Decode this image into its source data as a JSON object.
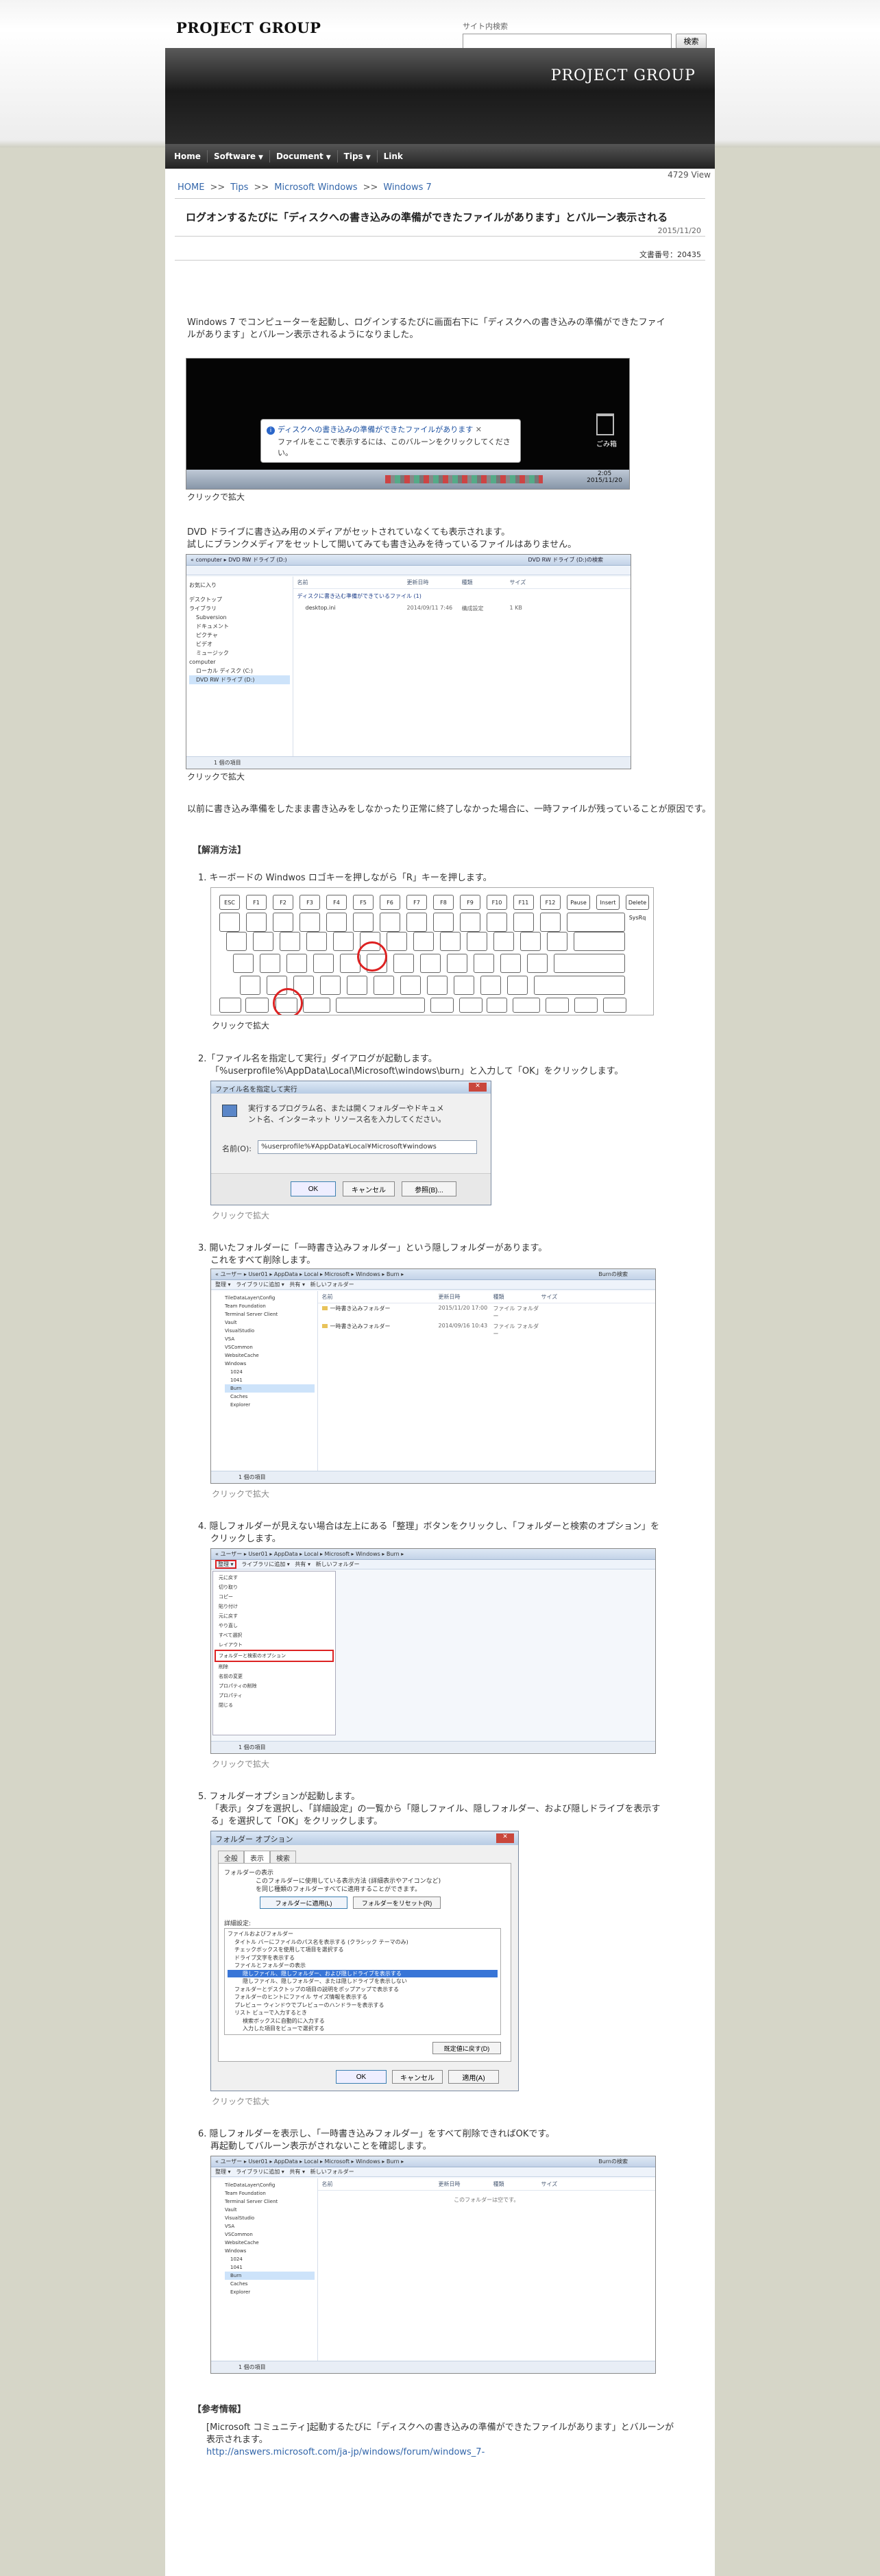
{
  "header": {
    "logo_text": "PROJECT GROUP",
    "search_label": "サイト内検索",
    "search_button": "検索",
    "search_value": ""
  },
  "banner": {
    "title": "PROJECT GROUP"
  },
  "nav": {
    "items": [
      {
        "label": "Home"
      },
      {
        "label": "Software",
        "dropdown": true
      },
      {
        "label": "Document",
        "dropdown": true
      },
      {
        "label": "Tips",
        "dropdown": true
      },
      {
        "label": "Link"
      }
    ]
  },
  "article": {
    "views": "4729 View",
    "breadcrumb": [
      "HOME",
      "Tips",
      "Microsoft Windows",
      "Windows 7"
    ],
    "breadcrumb_sep": ">>",
    "title": "ログオンするたびに「ディスクへの書き込みの準備ができたファイルがあります」とバルーン表示される",
    "date": "2015/11/20",
    "doc_no": "文書番号：20435",
    "intro_1": "Windows 7 でコンピューターを起動し、ログインするたびに画面右下に「ディスクへの書き込みの準備ができたファイ",
    "intro_2": "ルがあります」とバルーン表示されるようになりました。",
    "balloon_title": "ディスクへの書き込みの準備ができたファイルがあります",
    "balloon_body_1": "ファイルをここで表示するには、このバルーンをクリックしてくださ",
    "balloon_body_2": "い。",
    "recycle_label": "ごみ箱",
    "tray_time": "2:05",
    "tray_date": "2015/11/20",
    "enlarge": "クリックで拡大",
    "para_2a": "DVD ドライブに書き込み用のメディアがセットされていなくても表示されます。",
    "para_2b": "試しにブランクメディアをセットして開いてみても書き込みを待っているファイルはありません。",
    "para_3": "以前に書き込み準備をしたまま書き込みをしなかったり正常に終了しなかった場合に、一時ファイルが残っていることが原因です。",
    "solution_heading": "【解消方法】",
    "steps": [
      {
        "text": "1. キーボードの Windwos ロゴキーを押しながら「R」キーを押します。"
      },
      {
        "text": "2.「ファイル名を指定して実行」ダイアログが起動します。",
        "text2": "「%userprofile%\\AppData\\Local\\Microsoft\\windows\\burn」と入力して「OK」をクリックします。"
      },
      {
        "text": "3. 開いたフォルダーに「一時書き込みフォルダー」という隠しフォルダーがあります。",
        "text2": "これをすべて削除します。"
      },
      {
        "text": "4. 隠しフォルダーが見えない場合は左上にある「整理」ボタンをクリックし、「フォルダーと検索のオプション」を",
        "text2": "クリックします。"
      },
      {
        "text": "5. フォルダーオプションが起動します。",
        "text2": "「表示」タブを選択し、「詳細設定」の一覧から「隠しファイル、隠しフォルダー、および隠しドライブを表示す",
        "text3": "る」を選択して「OK」をクリックします。"
      },
      {
        "text": "6. 隠しフォルダーを表示し、「一時書き込みフォルダー」をすべて削除できればOKです。",
        "text2": "再起動してバルーン表示がされないことを確認します。"
      }
    ],
    "run_dialog": {
      "title": "ファイル名を指定して実行",
      "desc_1": "実行するプログラム名、または開くフォルダーやドキュメ",
      "desc_2": "ント名、インターネット リソース名を入力してください。",
      "name_label": "名前(O):",
      "name_value": "%userprofile%¥AppData¥Local¥Microsoft¥windows",
      "ok": "OK",
      "cancel": "キャンセル",
      "browse": "参照(B)..."
    },
    "explorer_1": {
      "path": "« computer ▸ DVD RW ドライブ (D:)",
      "search": "DVD RW ドライブ (D:)の検索",
      "col_name": "名前",
      "col_date": "更新日時",
      "col_type": "種類",
      "col_size": "サイズ",
      "group": "ディスクに書き込む準備ができているファイル (1)",
      "file_name": "desktop.ini",
      "file_date": "2014/09/11 7:46",
      "file_type": "構成設定",
      "file_size": "1 KB",
      "sidebar": [
        "お気に入り",
        "デスクトップ",
        "ライブラリ",
        "Subversion",
        "ドキュメント",
        "ピクチャ",
        "ビデオ",
        "ミュージック",
        "computer",
        "ローカル ディスク (C:)",
        "DVD RW ドライブ (D:)"
      ],
      "status": "1 個の項目"
    },
    "explorer_2": {
      "path": "« ユーザー ▸ User01 ▸ AppData ▸ Local ▸ Microsoft ▸ Windows ▸ Burn ▸",
      "search": "Burnの検索",
      "organize": "整理 ▾",
      "library": "ライブラリに追加 ▾",
      "share": "共有 ▾",
      "newfolder": "新しいフォルダー",
      "rows": [
        "一時書き込みフォルダー",
        "一時書き込みフォルダー"
      ],
      "row_dates": [
        "2015/11/20 17:00",
        "2014/09/16 10:43"
      ],
      "row_type": "ファイル フォルダー",
      "sidebar": [
        "TileDataLayer\\Config",
        "Team Foundation",
        "Terminal Server Client",
        "Vault",
        "VisualStudio",
        "VSA",
        "VSCommon",
        "WebsiteCache",
        "Windows",
        "1024",
        "1041",
        "Burn",
        "Caches",
        "Explorer"
      ],
      "status": "1 個の項目",
      "empty": "このフォルダーは空です。"
    },
    "organize_menu": [
      "元に戻す",
      "切り取り",
      "コピー",
      "貼り付け",
      "元に戻す",
      "やり直し",
      "すべて選択",
      "レイアウト",
      "フォルダーと検索のオプション",
      "削除",
      "名前の変更",
      "プロパティの削除",
      "プロパティ",
      "閉じる"
    ],
    "folder_options": {
      "title": "フォルダー オプション",
      "tabs": [
        "全般",
        "表示",
        "検索"
      ],
      "folder_view": "フォルダーの表示",
      "folder_view_desc_1": "このフォルダーに使用している表示方法 (詳細表示やアイコンなど)",
      "folder_view_desc_2": "を同じ種類のフォルダーすべてに適用することができます。",
      "apply_btn": "フォルダーに適用(L)",
      "reset_btn": "フォルダーをリセット(R)",
      "advanced": "詳細設定:",
      "items": [
        "ファイルおよびフォルダー",
        "タイトル バーにファイルのパス名を表示する (クラシック テーマのみ)",
        "チェックボックスを使用して項目を選択する",
        "ドライブ文字を表示する",
        "ファイルとフォルダーの表示",
        "隠しファイル、隠しフォルダー、および隠しドライブを表示する",
        "隠しファイル、隠しフォルダー、または隠しドライブを表示しない",
        "フォルダーとデスクトップの項目の説明をポップアップで表示する",
        "フォルダーのヒントにファイル サイズ情報を表示する",
        "プレビュー ウィンドウでプレビューのハンドラーを表示する",
        "リスト ビューで入力するとき",
        "検索ボックスに自動的に入力する",
        "入力した項目をビューで選択する"
      ],
      "restore": "既定値に戻す(D)",
      "ok": "OK",
      "cancel": "キャンセル",
      "apply": "適用(A)"
    },
    "keyboard_keys_row1": [
      "ESC",
      "F1",
      "F2",
      "F3",
      "F4",
      "F5",
      "F6",
      "F7",
      "F8",
      "F9",
      "F10",
      "F11",
      "F12",
      "Pause Break",
      "Insert PrtScr",
      "Delete SysRq"
    ],
    "ref_heading": "【参考情報】",
    "ref_text_1": "[Microsoft コミュニティ]起動するたびに「ディスクへの書き込みの準備ができたファイルがあります」とバルーンが",
    "ref_text_2": "表示されます。",
    "ref_link": "http://answers.microsoft.com/ja-jp/windows/forum/windows_7-"
  }
}
